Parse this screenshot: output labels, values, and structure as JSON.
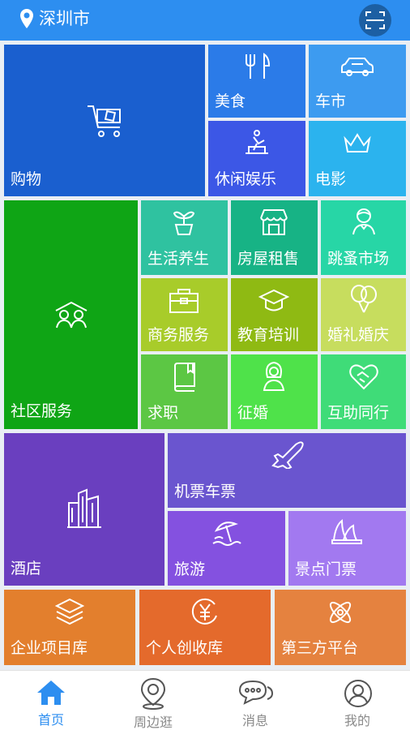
{
  "header": {
    "city": "深圳市"
  },
  "tiles": {
    "shopping": "购物",
    "food": "美食",
    "car": "车市",
    "leisure": "休闲娱乐",
    "movie": "电影",
    "community": "社区服务",
    "health": "生活养生",
    "rental": "房屋租售",
    "flea": "跳蚤市场",
    "business": "商务服务",
    "education": "教育培训",
    "wedding": "婚礼婚庆",
    "jobs": "求职",
    "dating": "征婚",
    "mutual": "互助同行",
    "hotel": "酒店",
    "tickets": "机票车票",
    "travel": "旅游",
    "scenic": "景点门票",
    "enterprise": "企业项目库",
    "personal": "个人创收库",
    "thirdparty": "第三方平台"
  },
  "colors": {
    "header": "#2d8ef0",
    "shopping": "#1a5fcf",
    "food": "#2b7be8",
    "car": "#3d9bf0",
    "leisure": "#3c57e6",
    "movie": "#2bb3ee",
    "community": "#0fa515",
    "health": "#2fc2a0",
    "rental": "#17b385",
    "flea": "#27d6a6",
    "business": "#a8cc2a",
    "education": "#8fba13",
    "wedding": "#c7dd5e",
    "jobs": "#5cc744",
    "dating": "#4fe24a",
    "mutual": "#3fdc78",
    "hotel": "#6a3fbf",
    "tickets": "#6a55cf",
    "travel": "#8451e0",
    "scenic": "#a279f0",
    "enterprise": "#e37f2d",
    "personal": "#e46a2c",
    "thirdparty": "#e5823f",
    "tab_active": "#2d8ef0",
    "tab_inactive": "#8a8a8a"
  },
  "tabbar": {
    "home": "首页",
    "nearby": "周边逛",
    "messages": "消息",
    "mine": "我的"
  },
  "icons": {
    "location": "location-pin-icon",
    "scan": "scan-icon",
    "shopping": "shopping-cart-icon",
    "food": "fork-knife-icon",
    "car": "car-icon",
    "leisure": "leisure-icon",
    "movie": "crown-icon",
    "community": "people-house-icon",
    "health": "sprout-pot-icon",
    "rental": "storefront-icon",
    "flea": "vendor-person-icon",
    "business": "briefcase-icon",
    "education": "graduation-cap-icon",
    "wedding": "balloons-icon",
    "jobs": "book-icon",
    "dating": "woman-icon",
    "mutual": "handshake-heart-icon",
    "hotel": "buildings-icon",
    "tickets": "airplane-icon",
    "travel": "beach-umbrella-icon",
    "scenic": "opera-house-icon",
    "enterprise": "layers-icon",
    "personal": "yen-icon",
    "thirdparty": "atom-icon"
  }
}
